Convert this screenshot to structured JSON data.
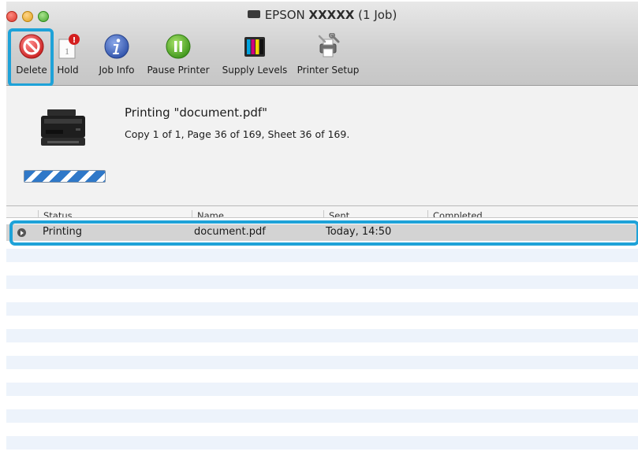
{
  "window": {
    "title_prefix": "EPSON",
    "title_model": "XXXXX",
    "title_suffix": "(1 Job)"
  },
  "toolbar": {
    "delete_label": "Delete",
    "hold_label": "Hold",
    "hold_badge": "!",
    "hold_page_number": "1",
    "job_info_label": "Job Info",
    "pause_label": "Pause Printer",
    "supply_label": "Supply Levels",
    "setup_label": "Printer Setup"
  },
  "job": {
    "title": "Printing \"document.pdf\"",
    "detail": "Copy 1 of 1, Page 36 of 169, Sheet 36 of 169.",
    "progress": 1.0
  },
  "list": {
    "columns": [
      "Status",
      "Name",
      "Sent",
      "Completed"
    ],
    "rows": [
      {
        "status": "Printing",
        "name": "document.pdf",
        "sent": "Today, 14:50",
        "completed": ""
      }
    ]
  },
  "colors": {
    "highlight": "#1ea2d8",
    "selected_row": "#d3d3d3",
    "stripe": "#edf3fb"
  }
}
